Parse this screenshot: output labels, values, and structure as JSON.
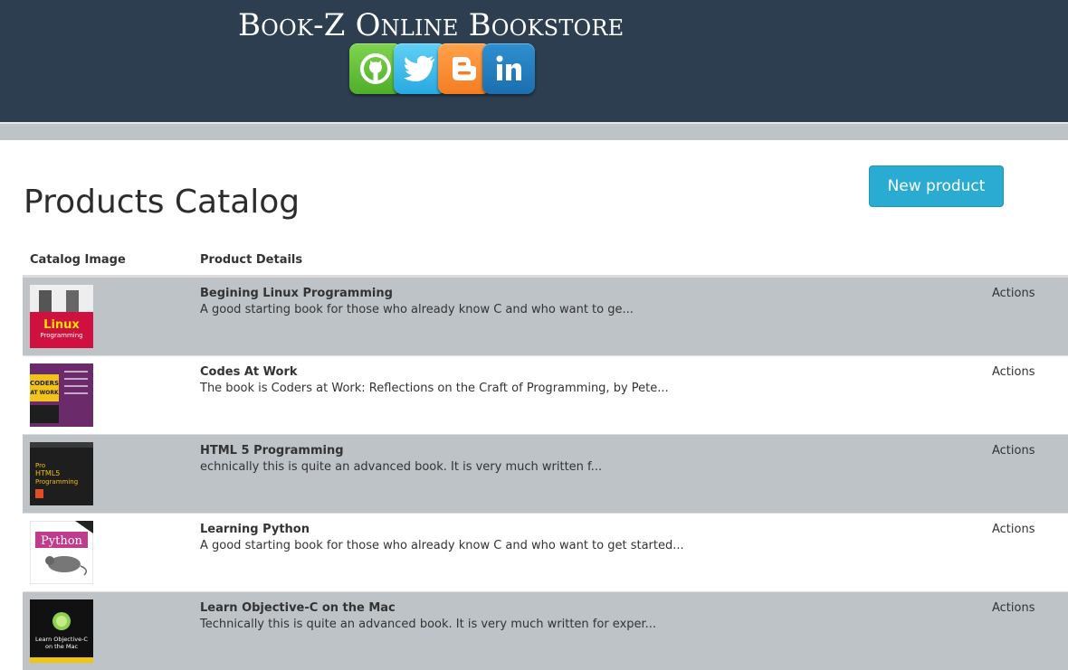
{
  "header": {
    "brand": "Book-Z Online Bookstore",
    "social_icons": [
      "github-icon",
      "twitter-icon",
      "blogger-icon",
      "linkedin-icon"
    ]
  },
  "main": {
    "title": "Products Catalog",
    "new_product_label": "New product"
  },
  "table": {
    "columns": [
      "Catalog Image",
      "Product Details"
    ],
    "rows": [
      {
        "title": "Begining Linux Programming",
        "description": "A good starting book for those who already know C and who want to ge...",
        "actions": "Actions",
        "cover": {
          "bg": "#d0113f",
          "top": "#eeeeee",
          "text": "Linux"
        }
      },
      {
        "title": "Codes At Work",
        "description": "The book is Coders at Work: Reflections on the Craft of Programming, by Pete...",
        "actions": "Actions",
        "cover": {
          "bg": "#6b2a6a",
          "top": "#f2c31b",
          "text": "CODERS AT WORK"
        }
      },
      {
        "title": "HTML 5 Programming",
        "description": "echnically this is quite an advanced book. It is very much written f...",
        "actions": "Actions",
        "cover": {
          "bg": "#1e1e1e",
          "top": "#2b2b2b",
          "text": "HTML5 Programming"
        }
      },
      {
        "title": "Learning Python",
        "description": "A good starting book for those who already know C and who want to get started...",
        "actions": "Actions",
        "cover": {
          "bg": "#ffffff",
          "top": "#c03b8b",
          "text": "Python"
        }
      },
      {
        "title": "Learn Objective-C on the Mac",
        "description": "Technically this is quite an advanced book. It is very much written for exper...",
        "actions": "Actions",
        "cover": {
          "bg": "#111111",
          "top": "#f1c40f",
          "text": "Learn Objective-C on the Mac"
        }
      }
    ]
  },
  "colors": {
    "header_bg": "#2c3e50",
    "band": "#bdc3c7",
    "accent_button": "#2aabd2"
  }
}
